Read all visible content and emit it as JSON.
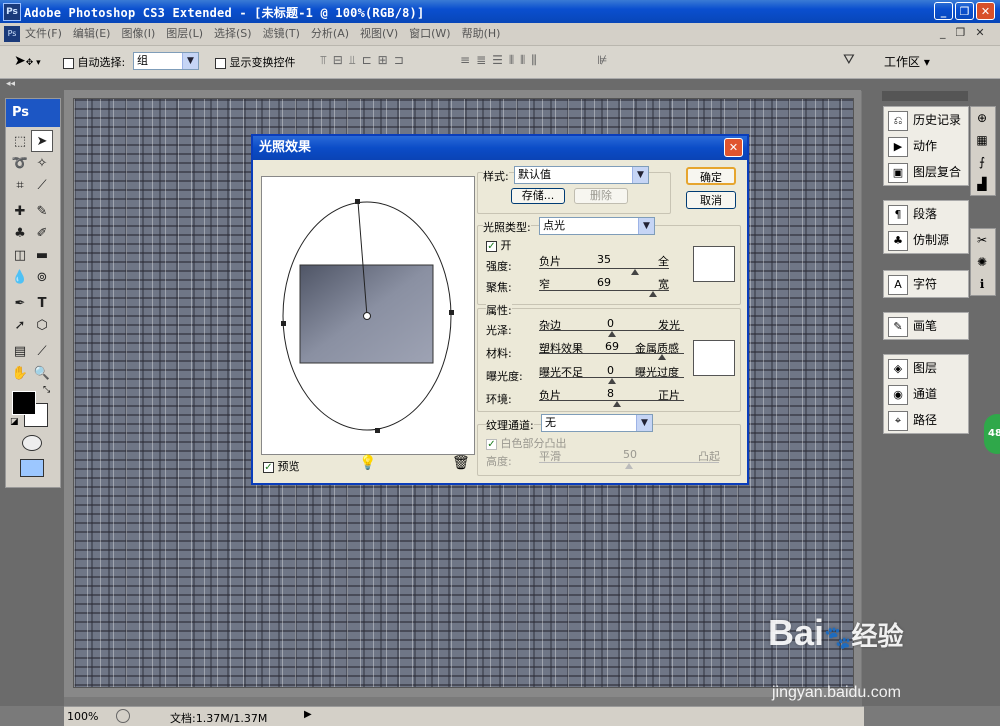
{
  "window": {
    "title": "Adobe Photoshop CS3 Extended - [未标题-1 @ 100%(RGB/8)]",
    "ps_logo": "Ps",
    "controls": [
      "_",
      "❐",
      "✕"
    ]
  },
  "menubar": {
    "items": [
      "文件(F)",
      "编辑(E)",
      "图像(I)",
      "图层(L)",
      "选择(S)",
      "滤镜(T)",
      "分析(A)",
      "视图(V)",
      "窗口(W)",
      "帮助(H)"
    ],
    "win_controls": [
      "_",
      "❐",
      "✕"
    ]
  },
  "options": {
    "auto_select_label": "自动选择:",
    "auto_select_value": "组",
    "show_transform_label": "显示变换控件",
    "workspace_label": "工作区"
  },
  "toolbox": {
    "header": "Ps"
  },
  "panels": {
    "group1": [
      "历史记录",
      "动作",
      "图层复合"
    ],
    "group2": [
      "段落",
      "仿制源"
    ],
    "group3": [
      "字符"
    ],
    "group4": [
      "画笔"
    ],
    "group5": [
      "图层",
      "通道",
      "路径"
    ]
  },
  "status": {
    "zoom": "100%",
    "doc": "文档:1.37M/1.37M"
  },
  "dialog": {
    "title": "光照效果",
    "style_label": "样式:",
    "style_value": "默认值",
    "save_button": "存储...",
    "delete_button": "删除",
    "ok_button": "确定",
    "cancel_button": "取消",
    "light_type_label": "光照类型:",
    "light_type_value": "点光",
    "on_label": "开",
    "intensity": {
      "label": "强度:",
      "left": "负片",
      "value": "35",
      "right": "全",
      "level": 0.74
    },
    "focus": {
      "label": "聚焦:",
      "left": "窄",
      "value": "69",
      "right": "宽",
      "level": 0.88
    },
    "properties_label": "属性:",
    "gloss": {
      "label": "光泽:",
      "left": "杂边",
      "value": "0",
      "right": "发光",
      "level": 0.5
    },
    "material": {
      "label": "材料:",
      "left": "塑料效果",
      "value": "69",
      "right": "金属质感",
      "level": 0.85
    },
    "exposure": {
      "label": "曝光度:",
      "left": "曝光不足",
      "value": "0",
      "right": "曝光过度",
      "level": 0.5
    },
    "ambience": {
      "label": "环境:",
      "left": "负片",
      "value": "8",
      "right": "正片",
      "level": 0.54
    },
    "texture_label": "纹理通道:",
    "texture_value": "无",
    "white_high_label": "白色部分凸出",
    "height": {
      "label": "高度:",
      "left": "平滑",
      "value": "50",
      "right": "凸起",
      "level": 0.5
    },
    "preview_label": "预览"
  },
  "watermark": {
    "brand": "Bai",
    "brand2": "经验",
    "url": "jingyan.baidu.com"
  },
  "side_badge": "48"
}
